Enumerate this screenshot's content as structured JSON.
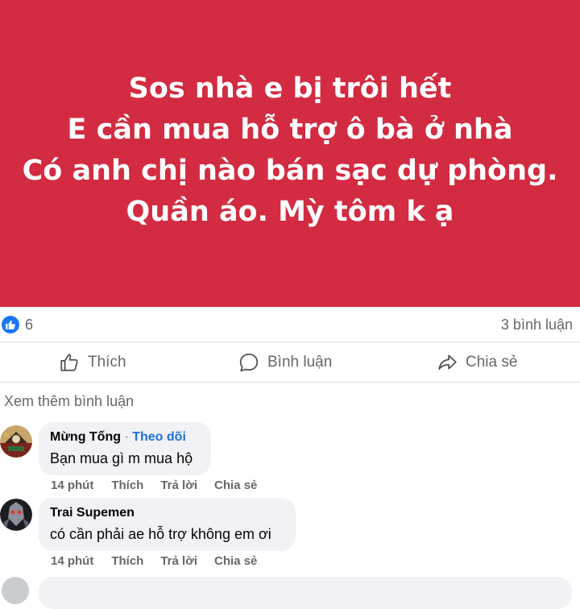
{
  "post": {
    "background_color": "#d32b41",
    "lines": [
      "Sos nhà e bị trôi hết",
      "E cần mua hỗ trợ ô bà ở nhà",
      "Có anh chị nào bán sạc dự phòng.",
      "Quần áo. Mỳ tôm k ạ"
    ]
  },
  "stats": {
    "reaction_icon": "like-icon",
    "reaction_count": "6",
    "comment_count": "3 bình luận"
  },
  "actions": {
    "like": "Thích",
    "comment": "Bình luận",
    "share": "Chia sẻ"
  },
  "view_more": "Xem thêm bình luận",
  "comments": [
    {
      "name": "Mừng Tống",
      "separator": "·",
      "follow": "Theo dõi",
      "text": "Bạn mua gì m mua hộ",
      "time": "14 phút",
      "like": "Thích",
      "reply": "Trả lời",
      "share": "Chia sẻ"
    },
    {
      "name": "Trai Supemen",
      "text": "có cần phải ae hỗ trợ không em ơi",
      "time": "14 phút",
      "like": "Thích",
      "reply": "Trả lời",
      "share": "Chia sẻ"
    }
  ],
  "colors": {
    "accent": "#1877f2",
    "follow_link": "#216fdb",
    "muted_text": "#65676b",
    "bubble": "#f0f2f5"
  }
}
